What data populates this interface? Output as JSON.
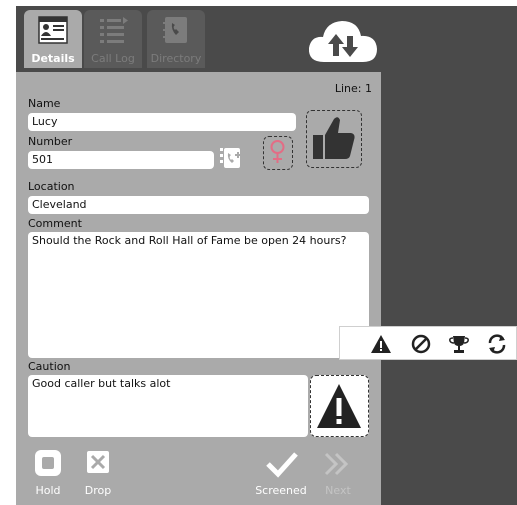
{
  "tabs": [
    {
      "label": "Details",
      "icon": "details-card-icon",
      "active": true
    },
    {
      "label": "Call Log",
      "icon": "call-log-list-icon",
      "active": false
    },
    {
      "label": "Directory",
      "icon": "directory-book-icon",
      "active": false
    }
  ],
  "header": {
    "sync_icon": "cloud-sync-icon",
    "line_label": "Line: 1"
  },
  "form": {
    "name_label": "Name",
    "name_value": "Lucy",
    "number_label": "Number",
    "number_value": "501",
    "location_label": "Location",
    "location_value": "Cleveland",
    "comment_label": "Comment",
    "comment_value": "Should the Rock and Roll Hall of Fame be open 24 hours?",
    "caution_label": "Caution",
    "caution_value": "Good caller but talks alot"
  },
  "icons": {
    "add_contact": "add-to-directory-icon",
    "gender": "female-icon",
    "rating": "thumbs-up-icon",
    "caution": "warning-icon"
  },
  "flag_toolbar": [
    "warning-icon",
    "block-icon",
    "trophy-icon",
    "refresh-icon"
  ],
  "bottom_bar": {
    "hold_label": "Hold",
    "drop_label": "Drop",
    "screened_label": "Screened",
    "next_label": "Next"
  },
  "colors": {
    "panel_bg": "#aaaaaa",
    "dark_bg": "#4a4a4a",
    "inactive_tab": "#5a5a5a",
    "female_icon": "#e36d85"
  }
}
